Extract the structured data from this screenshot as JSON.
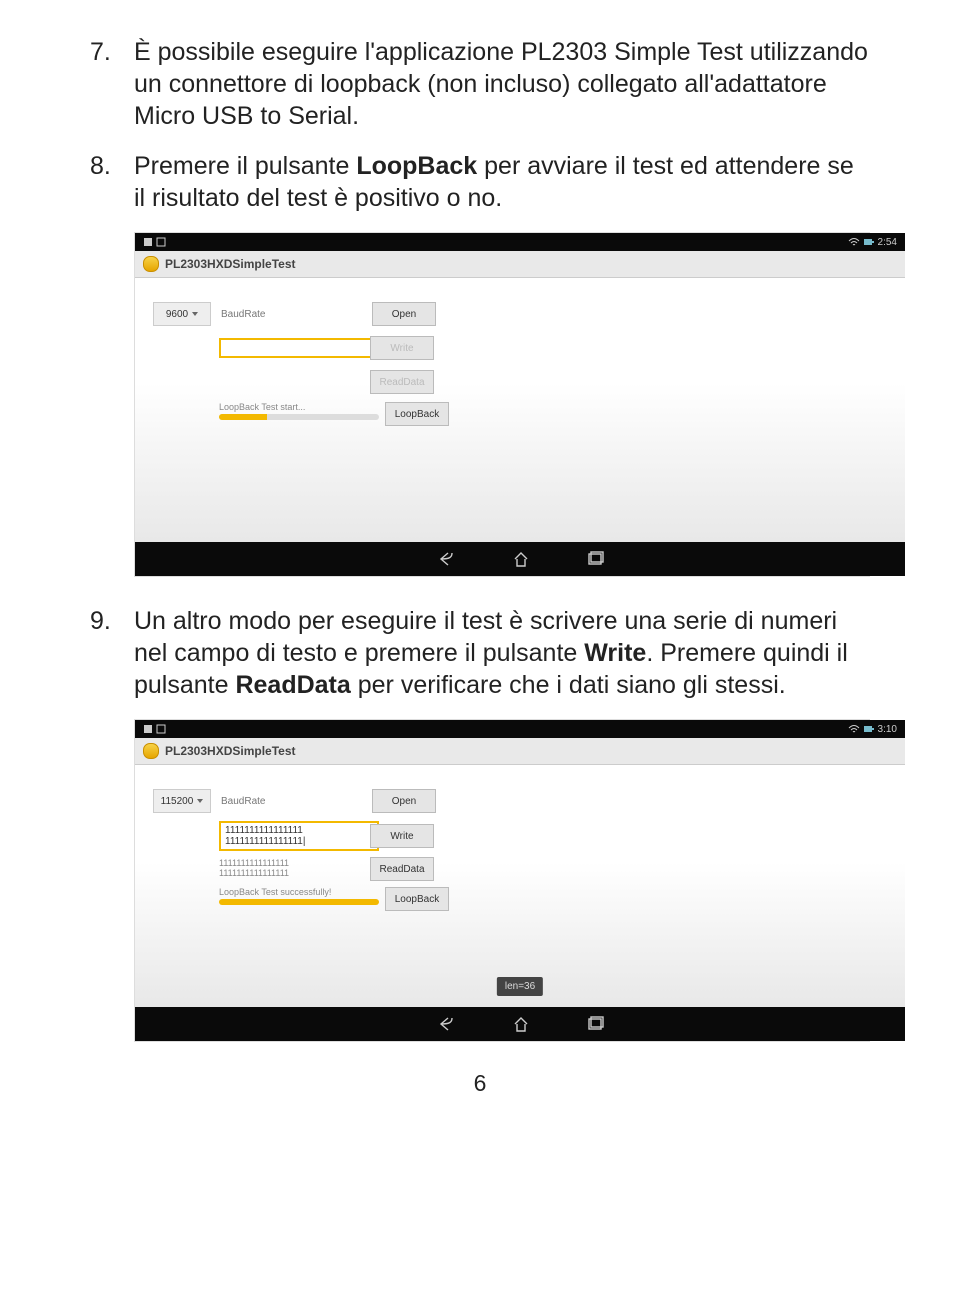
{
  "items": {
    "n7": {
      "num": "7.",
      "text_a": "È possibile eseguire l'applicazione PL2303 Simple Test utilizzando un connettore di loopback (non incluso) collegato all'adattatore Micro USB to Serial."
    },
    "n8": {
      "num": "8.",
      "text_a": "Premere il pulsante ",
      "bold_a": "LoopBack",
      "text_b": " per avviare il test ed attendere se il risultato del test è positivo o no."
    },
    "n9": {
      "num": "9.",
      "text_a": "Un altro modo per eseguire il test è scrivere una serie di numeri nel campo di testo e premere il pulsante ",
      "bold_a": "Write",
      "text_b": ". Premere quindi il pulsante ",
      "bold_b": "ReadData",
      "text_c": " per verificare che i dati siano gli stessi."
    }
  },
  "shot1": {
    "time": "2:54",
    "app_title": "PL2303HXDSimpleTest",
    "baud_value": "9600",
    "baud_label": "BaudRate",
    "btn_open": "Open",
    "btn_write": "Write",
    "btn_read": "ReadData",
    "btn_loop": "LoopBack",
    "status": "LoopBack Test start...",
    "progress_pct": 30
  },
  "shot2": {
    "time": "3:10",
    "app_title": "PL2303HXDSimpleTest",
    "baud_value": "115200",
    "baud_label": "BaudRate",
    "btn_open": "Open",
    "btn_write": "Write",
    "btn_read": "ReadData",
    "btn_loop": "LoopBack",
    "write_val": "1111111111111111\n1111111111111111|",
    "read_val": "1111111111111111\n1111111111111111",
    "status": "LoopBack Test successfully!",
    "progress_pct": 100,
    "toast": "len=36"
  },
  "page_number": "6"
}
